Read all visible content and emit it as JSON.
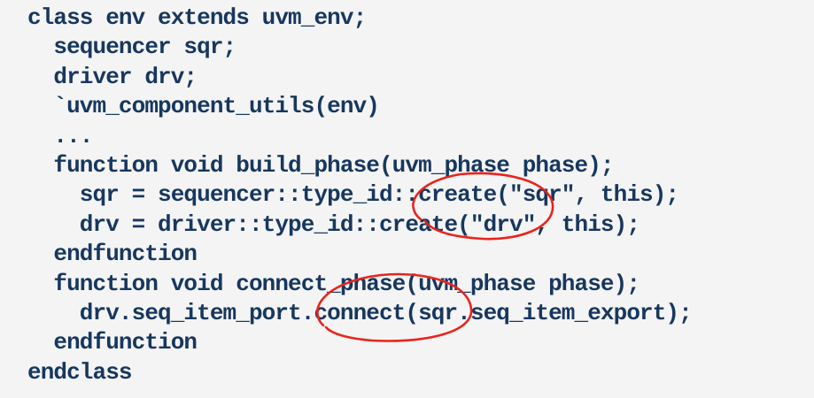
{
  "code_lines": [
    "class env extends uvm_env;",
    "  sequencer sqr;",
    "  driver drv;",
    "  `uvm_component_utils(env)",
    "  ...",
    "  function void build_phase(uvm_phase phase);",
    "    sqr = sequencer::type_id::create(\"sqr\", this);",
    "    drv = driver::type_id::create(\"drv\", this);",
    "  endfunction",
    "  function void connect_phase(uvm_phase phase);",
    "    drv.seq_item_port.connect(sqr.seq_item_export);",
    "  endfunction",
    "endclass"
  ],
  "colors": {
    "code_text": "#17375e",
    "annotation": "#e8241c",
    "background": "#f4f4f4"
  }
}
